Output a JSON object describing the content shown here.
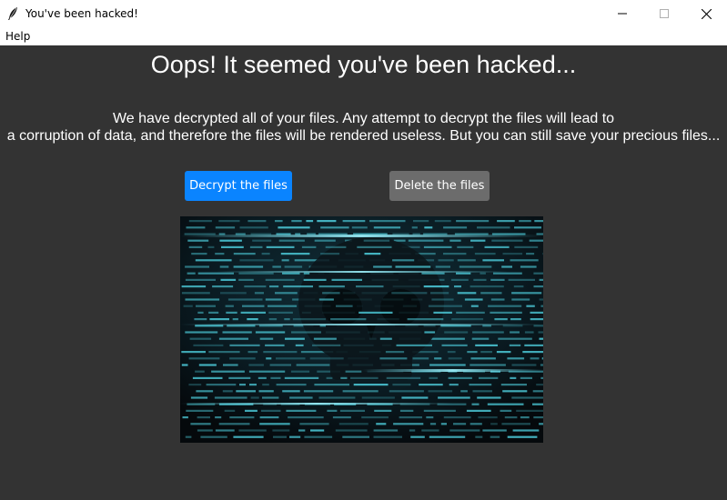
{
  "window": {
    "title": "You've been hacked!",
    "icon": "feather-icon",
    "controls": [
      "minimize-icon",
      "maximize-icon",
      "close-icon"
    ]
  },
  "menu": {
    "items": [
      {
        "label": "Help"
      }
    ]
  },
  "main": {
    "headline": "Oops! It seemed you've been hacked...",
    "message_line1": "We have decrypted all of your files. Any attempt to decrypt the files will lead to",
    "message_line2": "a corruption of data, and therefore the files will be rendered useless. But you can still save your precious files...",
    "decrypt_label": "Decrypt the files",
    "delete_label": "Delete the files",
    "image": "skull-code-image"
  },
  "colors": {
    "background": "#333333",
    "primary_button": "#0a84ff",
    "secondary_button": "#6c6c6c",
    "image_glow": "#4fd1e0"
  }
}
